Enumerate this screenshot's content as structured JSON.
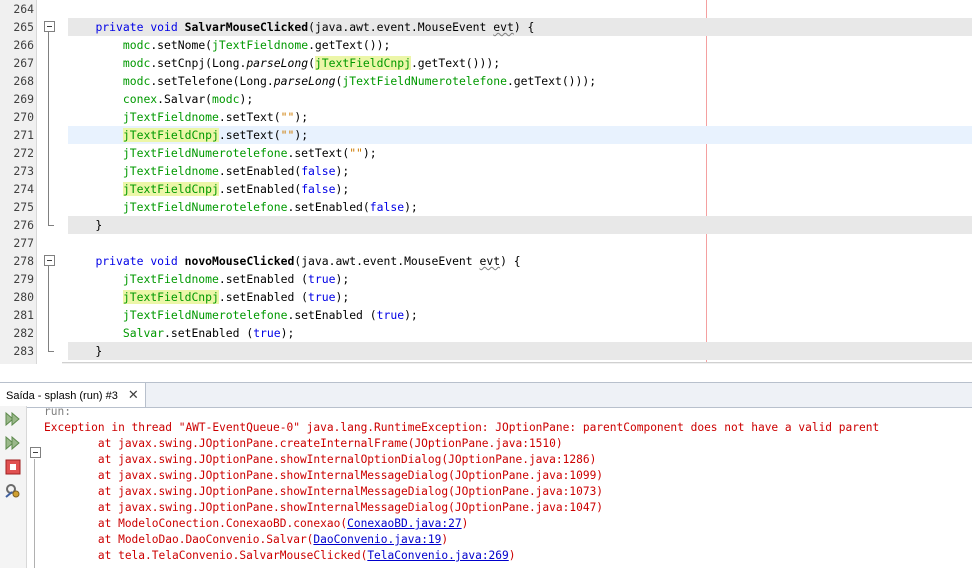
{
  "editor": {
    "lines": [
      {
        "num": "264",
        "segs": []
      },
      {
        "num": "265",
        "hl": "gray",
        "fold": "start",
        "segs": [
          {
            "t": "    "
          },
          {
            "t": "private",
            "c": "kw"
          },
          {
            "t": " "
          },
          {
            "t": "void",
            "c": "kw"
          },
          {
            "t": " "
          },
          {
            "t": "SalvarMouseClicked",
            "c": "b"
          },
          {
            "t": "(java.awt.event.MouseEvent "
          },
          {
            "t": "evt",
            "c": "sq"
          },
          {
            "t": ") {"
          }
        ]
      },
      {
        "num": "266",
        "segs": [
          {
            "t": "        "
          },
          {
            "t": "modc",
            "c": "fld"
          },
          {
            "t": ".setNome("
          },
          {
            "t": "jTextFieldnome",
            "c": "fld"
          },
          {
            "t": ".getText());"
          }
        ]
      },
      {
        "num": "267",
        "segs": [
          {
            "t": "        "
          },
          {
            "t": "modc",
            "c": "fld"
          },
          {
            "t": ".setCnpj(Long."
          },
          {
            "t": "parseLong",
            "c": "it"
          },
          {
            "t": "("
          },
          {
            "t": "jTextFieldCnpj",
            "c": "hlf"
          },
          {
            "t": ".getText()));"
          }
        ]
      },
      {
        "num": "268",
        "segs": [
          {
            "t": "        "
          },
          {
            "t": "modc",
            "c": "fld"
          },
          {
            "t": ".setTelefone(Long."
          },
          {
            "t": "parseLong",
            "c": "it"
          },
          {
            "t": "("
          },
          {
            "t": "jTextFieldNumerotelefone",
            "c": "fld"
          },
          {
            "t": ".getText()));"
          }
        ]
      },
      {
        "num": "269",
        "segs": [
          {
            "t": "        "
          },
          {
            "t": "conex",
            "c": "fld"
          },
          {
            "t": ".Salvar("
          },
          {
            "t": "modc",
            "c": "fld"
          },
          {
            "t": ");"
          }
        ]
      },
      {
        "num": "270",
        "segs": [
          {
            "t": "        "
          },
          {
            "t": "jTextFieldnome",
            "c": "fld"
          },
          {
            "t": ".setText("
          },
          {
            "t": "\"\"",
            "c": "str"
          },
          {
            "t": ");"
          }
        ]
      },
      {
        "num": "271",
        "hl": "cur",
        "segs": [
          {
            "t": "        "
          },
          {
            "t": "jTextFieldCnpj",
            "c": "hlf"
          },
          {
            "t": ".setText("
          },
          {
            "t": "\"\"",
            "c": "str"
          },
          {
            "t": ");"
          }
        ]
      },
      {
        "num": "272",
        "segs": [
          {
            "t": "        "
          },
          {
            "t": "jTextFieldNumerotelefone",
            "c": "fld"
          },
          {
            "t": ".setText("
          },
          {
            "t": "\"\"",
            "c": "str"
          },
          {
            "t": ");"
          }
        ]
      },
      {
        "num": "273",
        "segs": [
          {
            "t": "        "
          },
          {
            "t": "jTextFieldnome",
            "c": "fld"
          },
          {
            "t": ".setEnabled("
          },
          {
            "t": "false",
            "c": "kw"
          },
          {
            "t": ");"
          }
        ]
      },
      {
        "num": "274",
        "segs": [
          {
            "t": "        "
          },
          {
            "t": "jTextFieldCnpj",
            "c": "hlf"
          },
          {
            "t": ".setEnabled("
          },
          {
            "t": "false",
            "c": "kw"
          },
          {
            "t": ");"
          }
        ]
      },
      {
        "num": "275",
        "segs": [
          {
            "t": "        "
          },
          {
            "t": "jTextFieldNumerotelefone",
            "c": "fld"
          },
          {
            "t": ".setEnabled("
          },
          {
            "t": "false",
            "c": "kw"
          },
          {
            "t": ");"
          }
        ]
      },
      {
        "num": "276",
        "hl": "gray",
        "fold": "end",
        "segs": [
          {
            "t": "    }"
          }
        ]
      },
      {
        "num": "277",
        "segs": []
      },
      {
        "num": "278",
        "fold": "start",
        "segs": [
          {
            "t": "    "
          },
          {
            "t": "private",
            "c": "kw"
          },
          {
            "t": " "
          },
          {
            "t": "void",
            "c": "kw"
          },
          {
            "t": " "
          },
          {
            "t": "novoMouseClicked",
            "c": "b"
          },
          {
            "t": "(java.awt.event.MouseEvent "
          },
          {
            "t": "evt",
            "c": "sq"
          },
          {
            "t": ") {"
          }
        ]
      },
      {
        "num": "279",
        "segs": [
          {
            "t": "        "
          },
          {
            "t": "jTextFieldnome",
            "c": "fld"
          },
          {
            "t": ".setEnabled ("
          },
          {
            "t": "true",
            "c": "kw"
          },
          {
            "t": ");"
          }
        ]
      },
      {
        "num": "280",
        "segs": [
          {
            "t": "        "
          },
          {
            "t": "jTextFieldCnpj",
            "c": "hlf"
          },
          {
            "t": ".setEnabled ("
          },
          {
            "t": "true",
            "c": "kw"
          },
          {
            "t": ");"
          }
        ]
      },
      {
        "num": "281",
        "segs": [
          {
            "t": "        "
          },
          {
            "t": "jTextFieldNumerotelefone",
            "c": "fld"
          },
          {
            "t": ".setEnabled ("
          },
          {
            "t": "true",
            "c": "kw"
          },
          {
            "t": ");"
          }
        ]
      },
      {
        "num": "282",
        "segs": [
          {
            "t": "        "
          },
          {
            "t": "Salvar",
            "c": "fld"
          },
          {
            "t": ".setEnabled ("
          },
          {
            "t": "true",
            "c": "kw"
          },
          {
            "t": ");"
          }
        ]
      },
      {
        "num": "283",
        "hl": "gray",
        "fold": "end",
        "segs": [
          {
            "t": "    }"
          }
        ]
      }
    ]
  },
  "output": {
    "tab_label": "Saída - splash (run) #3",
    "close_glyph": "✕",
    "toolbar_icons": [
      "rerun-icon",
      "rerun-green-icon",
      "stop-icon",
      "settings-icon"
    ],
    "lines": [
      {
        "segs": [
          {
            "t": "run:"
          }
        ],
        "gray": true
      },
      {
        "segs": [
          {
            "t": "Exception in thread \"AWT-EventQueue-0\" java.lang.RuntimeException: JOptionPane: parentComponent does not have a valid parent"
          }
        ],
        "fold": true
      },
      {
        "segs": [
          {
            "t": "\tat javax.swing.JOptionPane.createInternalFrame(JOptionPane.java:1510)"
          }
        ]
      },
      {
        "segs": [
          {
            "t": "\tat javax.swing.JOptionPane.showInternalOptionDialog(JOptionPane.java:1286)"
          }
        ]
      },
      {
        "segs": [
          {
            "t": "\tat javax.swing.JOptionPane.showInternalMessageDialog(JOptionPane.java:1099)"
          }
        ]
      },
      {
        "segs": [
          {
            "t": "\tat javax.swing.JOptionPane.showInternalMessageDialog(JOptionPane.java:1073)"
          }
        ]
      },
      {
        "segs": [
          {
            "t": "\tat javax.swing.JOptionPane.showInternalMessageDialog(JOptionPane.java:1047)"
          }
        ]
      },
      {
        "segs": [
          {
            "t": "\tat ModeloConection.ConexaoBD.conexao("
          },
          {
            "t": "ConexaoBD.java:27",
            "c": "lnk"
          },
          {
            "t": ")"
          }
        ]
      },
      {
        "segs": [
          {
            "t": "\tat ModeloDao.DaoConvenio.Salvar("
          },
          {
            "t": "DaoConvenio.java:19",
            "c": "lnk"
          },
          {
            "t": ")"
          }
        ]
      },
      {
        "segs": [
          {
            "t": "\tat tela.TelaConvenio.SalvarMouseClicked("
          },
          {
            "t": "TelaConvenio.java:269",
            "c": "lnk"
          },
          {
            "t": ")"
          }
        ]
      }
    ]
  }
}
